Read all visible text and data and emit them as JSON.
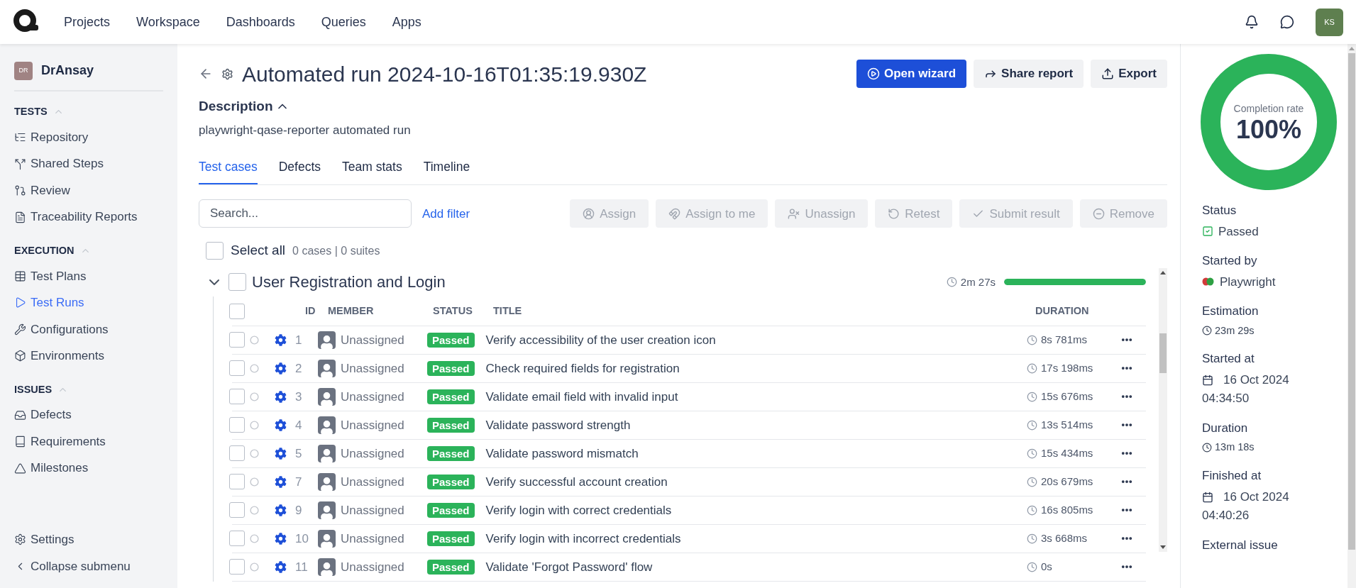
{
  "nav": {
    "items": [
      "Projects",
      "Workspace",
      "Dashboards",
      "Queries",
      "Apps"
    ],
    "user_initials": "KS"
  },
  "sidebar": {
    "project": {
      "initials": "DR",
      "name": "DrAnsay"
    },
    "sections": [
      {
        "title": "TESTS",
        "expanded": true,
        "items": [
          {
            "label": "Repository",
            "selected": false
          },
          {
            "label": "Shared Steps",
            "selected": false
          },
          {
            "label": "Review",
            "selected": false
          },
          {
            "label": "Traceability Reports",
            "selected": false
          }
        ]
      },
      {
        "title": "EXECUTION",
        "expanded": true,
        "items": [
          {
            "label": "Test Plans",
            "selected": false
          },
          {
            "label": "Test Runs",
            "selected": true
          },
          {
            "label": "Configurations",
            "selected": false
          },
          {
            "label": "Environments",
            "selected": false
          }
        ]
      },
      {
        "title": "ISSUES",
        "expanded": true,
        "items": [
          {
            "label": "Defects",
            "selected": false
          },
          {
            "label": "Requirements",
            "selected": false
          },
          {
            "label": "Milestones",
            "selected": false
          }
        ]
      }
    ],
    "footer": [
      "Settings",
      "Collapse submenu"
    ]
  },
  "header": {
    "title": "Automated run 2024-10-16T01:35:19.930Z",
    "buttons": [
      {
        "label": "Open wizard",
        "kind": "primary"
      },
      {
        "label": "Share report",
        "kind": "secondary"
      },
      {
        "label": "Export",
        "kind": "secondary"
      }
    ]
  },
  "description": {
    "label": "Description",
    "expanded": true,
    "text": "playwright-qase-reporter automated run"
  },
  "tabs": [
    {
      "label": "Test cases",
      "selected": true
    },
    {
      "label": "Defects",
      "selected": false
    },
    {
      "label": "Team stats",
      "selected": false
    },
    {
      "label": "Timeline",
      "selected": false
    }
  ],
  "search": {
    "placeholder": "Search..."
  },
  "add_filter": "Add filter",
  "actions": [
    {
      "label": "Assign",
      "disabled": true
    },
    {
      "label": "Assign to me",
      "disabled": true
    },
    {
      "label": "Unassign",
      "disabled": true
    },
    {
      "label": "Retest",
      "disabled": true
    },
    {
      "label": "Submit result",
      "disabled": true
    },
    {
      "label": "Remove",
      "disabled": true
    }
  ],
  "select_all": {
    "label": "Select all",
    "checked": false,
    "summary": "0 cases | 0 suites"
  },
  "suite": {
    "title": "User Registration and Login",
    "expanded": true,
    "checked": false,
    "header_checked": false,
    "duration": "2m 27s",
    "level": 1,
    "columns": [
      "ID",
      "MEMBER",
      "STATUS",
      "TITLE",
      "DURATION"
    ],
    "rows": [
      {
        "id": "1",
        "member": "Unassigned",
        "status": "Passed",
        "title": "Verify accessibility of the user creation icon",
        "duration": "8s 781ms",
        "checked": false
      },
      {
        "id": "2",
        "member": "Unassigned",
        "status": "Passed",
        "title": "Check required fields for registration",
        "duration": "17s 198ms",
        "checked": false
      },
      {
        "id": "3",
        "member": "Unassigned",
        "status": "Passed",
        "title": "Validate email field with invalid input",
        "duration": "15s 676ms",
        "checked": false
      },
      {
        "id": "4",
        "member": "Unassigned",
        "status": "Passed",
        "title": "Validate password strength",
        "duration": "13s 514ms",
        "checked": false
      },
      {
        "id": "5",
        "member": "Unassigned",
        "status": "Passed",
        "title": "Validate password mismatch",
        "duration": "15s 434ms",
        "checked": false
      },
      {
        "id": "7",
        "member": "Unassigned",
        "status": "Passed",
        "title": "Verify successful account creation",
        "duration": "20s 679ms",
        "checked": false
      },
      {
        "id": "9",
        "member": "Unassigned",
        "status": "Passed",
        "title": "Verify login with correct credentials",
        "duration": "16s 805ms",
        "checked": false
      },
      {
        "id": "10",
        "member": "Unassigned",
        "status": "Passed",
        "title": "Verify login with incorrect credentials",
        "duration": "3s 668ms",
        "checked": false
      },
      {
        "id": "11",
        "member": "Unassigned",
        "status": "Passed",
        "title": "Validate 'Forgot Password' flow",
        "duration": "0s",
        "checked": false
      }
    ]
  },
  "completion": {
    "label": "Completion rate",
    "value": "100%",
    "level": 1
  },
  "details": [
    {
      "kind": "status",
      "label": "Status",
      "value": "Passed"
    },
    {
      "kind": "user",
      "label": "Started by",
      "value": "Playwright"
    },
    {
      "kind": "duration",
      "label": "Estimation",
      "value": "23m 29s"
    },
    {
      "kind": "datetime",
      "label": "Started at",
      "value": "16 Oct 2024",
      "time": "04:34:50"
    },
    {
      "kind": "duration",
      "label": "Duration",
      "value": "13m 18s"
    },
    {
      "kind": "datetime",
      "label": "Finished at",
      "value": "16 Oct 2024",
      "time": "04:40:26"
    },
    {
      "kind": "label",
      "label": "External issue"
    }
  ]
}
